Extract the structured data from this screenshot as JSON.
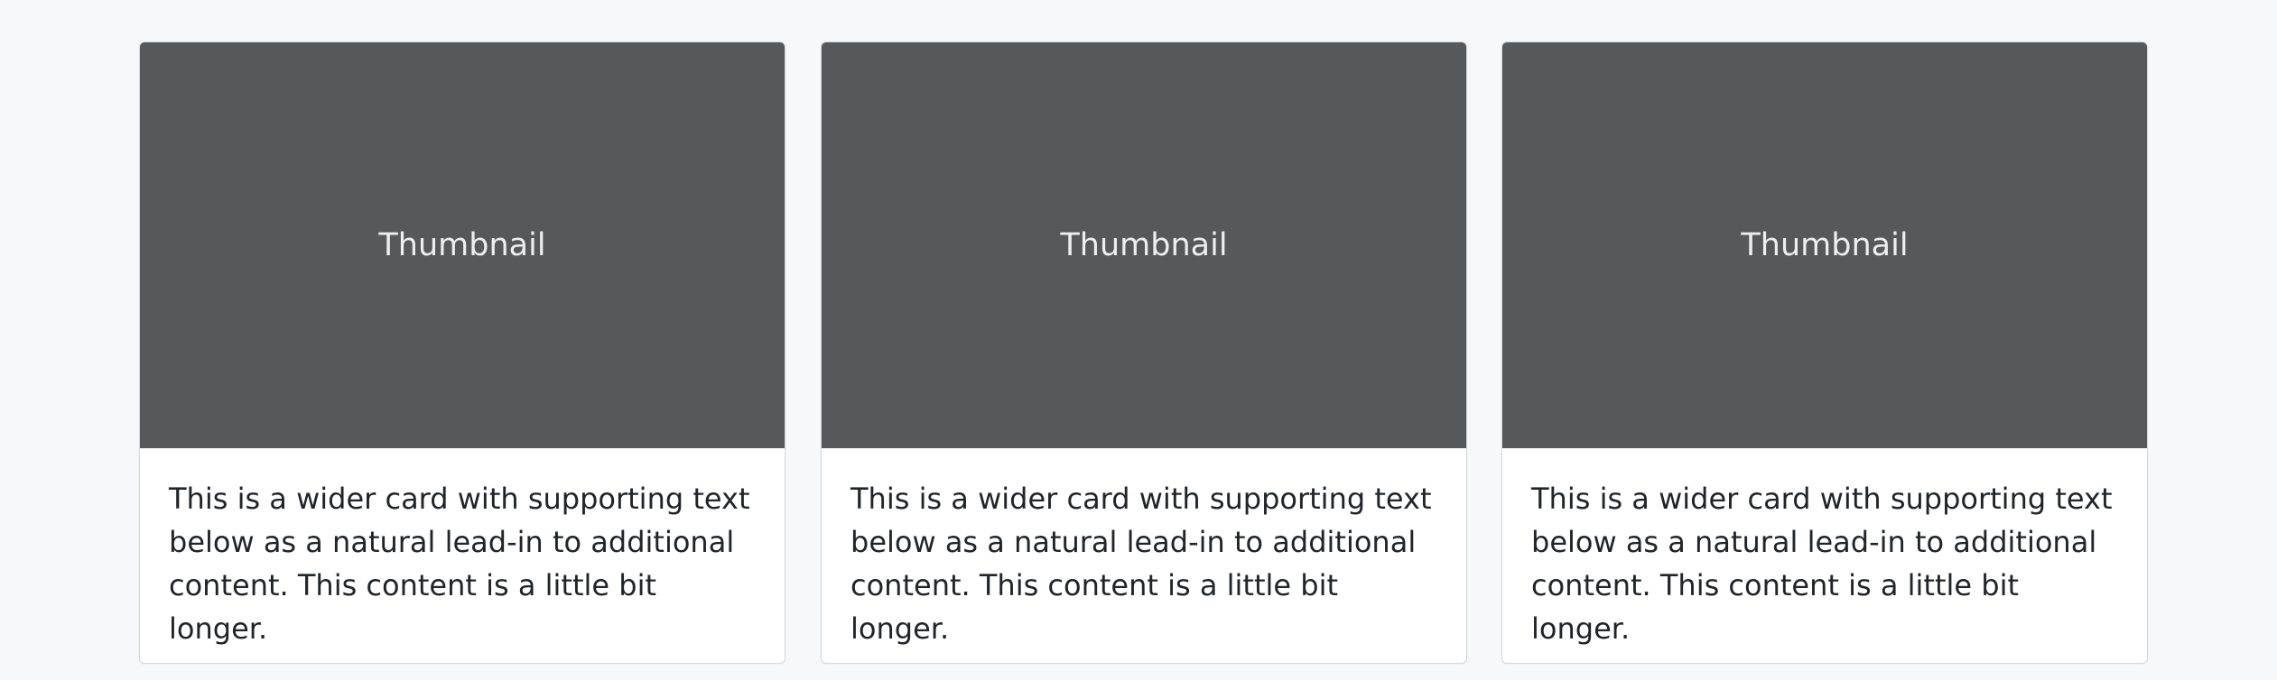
{
  "cards": [
    {
      "thumbnail_label": "Thumbnail",
      "text": "This is a wider card with supporting text below as a natural lead-in to additional content. This content is a little bit longer."
    },
    {
      "thumbnail_label": "Thumbnail",
      "text": "This is a wider card with supporting text below as a natural lead-in to additional content. This content is a little bit longer."
    },
    {
      "thumbnail_label": "Thumbnail",
      "text": "This is a wider card with supporting text below as a natural lead-in to additional content. This content is a little bit longer."
    }
  ],
  "colors": {
    "page_background": "#f7f8f9",
    "thumbnail_background": "#55595c",
    "thumbnail_text": "#eceeef",
    "card_background": "#ffffff",
    "body_text": "#212529"
  }
}
